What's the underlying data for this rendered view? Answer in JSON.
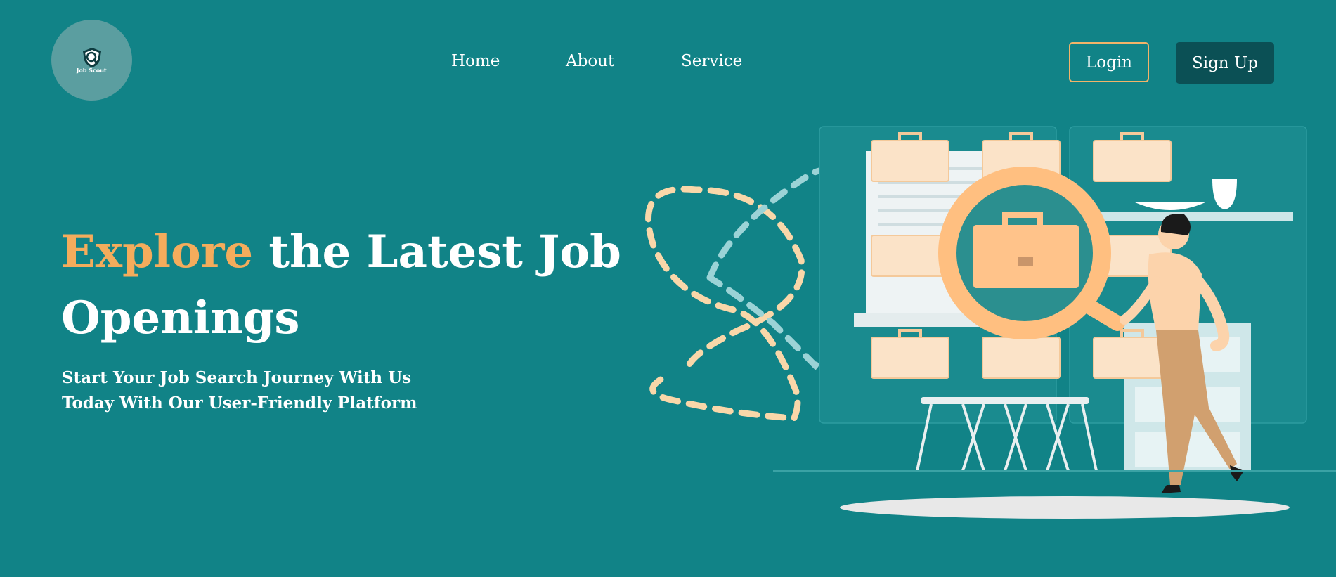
{
  "brand": {
    "logo_text": "Job Scout",
    "logo_icon": "shield-search-icon"
  },
  "nav": {
    "items": [
      {
        "label": "Home"
      },
      {
        "label": "About"
      },
      {
        "label": "Service"
      }
    ]
  },
  "auth": {
    "login_label": "Login",
    "signup_label": "Sign Up"
  },
  "hero": {
    "title_accent": "Explore",
    "title_rest": " the Latest Job Openings",
    "subtitle_line1": "Start Your Job Search Journey With Us",
    "subtitle_line2": "Today With Our User-Friendly Platform",
    "illustration": "job-search-illustration"
  },
  "colors": {
    "background": "#118387",
    "accent": "#f4ac5c",
    "login_border": "#f2b469",
    "signup_bg": "#0b5055",
    "logo_bg": "#5b9ea0"
  }
}
